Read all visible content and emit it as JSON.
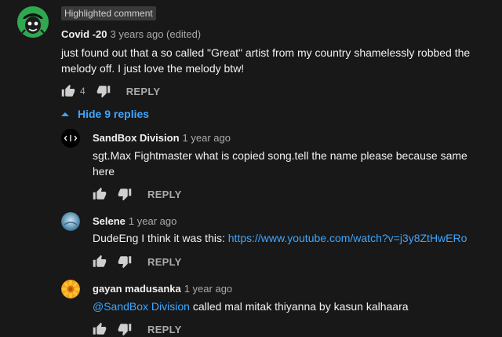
{
  "main_comment": {
    "badge": "Highlighted comment",
    "author": "Covid -20",
    "time": "3 years ago (edited)",
    "text": "just found out that a so called \"Great\" artist from my country shamelessly robbed the melody off. I just love the melody btw!",
    "likes": "4",
    "reply_label": "REPLY",
    "avatar_icon": "alien-face-icon"
  },
  "replies_toggle": {
    "label": "Hide 9 replies",
    "icon": "caret-up-icon"
  },
  "replies": [
    {
      "author": "SandBox Division",
      "time": "1 year ago",
      "text": "sgt.Max Fightmaster what is copied song.tell the name please because same here",
      "reply_label": "REPLY",
      "avatar_icon": "code-brackets-icon"
    },
    {
      "author": "Selene",
      "time": "1 year ago",
      "text_prefix": "DudeEng I think it was this: ",
      "link": "https://www.youtube.com/watch?v=j3y8ZtHwERo",
      "reply_label": "REPLY",
      "avatar_icon": "landscape-photo-icon"
    },
    {
      "author": "gayan madusanka",
      "time": "1 year ago",
      "mention": "@SandBox Division",
      "text_suffix": " called mal mitak thiyanna by kasun kalhaara",
      "reply_label": "REPLY",
      "avatar_icon": "sunflower-icon"
    }
  ],
  "colors": {
    "background": "#181818",
    "link": "#3ea6ff",
    "muted": "#aaaaaa",
    "avatar_main": "#2fa84f"
  }
}
